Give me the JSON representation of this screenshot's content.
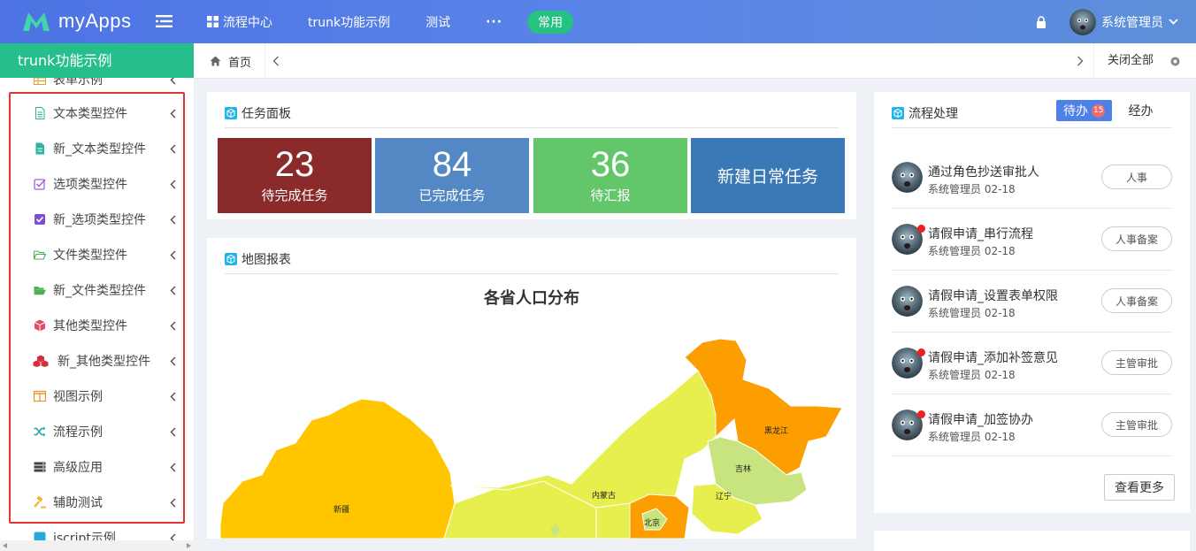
{
  "app": {
    "logo_text": "myApps"
  },
  "nav": {
    "items": [
      "流程中心",
      "trunk功能示例",
      "测试"
    ],
    "more": "···",
    "pill": "常用"
  },
  "user": {
    "name": "系统管理员"
  },
  "sidebar": {
    "title": "trunk功能示例",
    "items": [
      {
        "label": "表单示例",
        "icon": "table-icon"
      },
      {
        "label": "文本类型控件",
        "icon": "file-text-icon"
      },
      {
        "label": "新_文本类型控件",
        "icon": "file-solid-icon"
      },
      {
        "label": "选项类型控件",
        "icon": "checkbox-icon"
      },
      {
        "label": "新_选项类型控件",
        "icon": "checkbox-solid-icon"
      },
      {
        "label": "文件类型控件",
        "icon": "folder-open-icon"
      },
      {
        "label": "新_文件类型控件",
        "icon": "folder-solid-icon"
      },
      {
        "label": "其他类型控件",
        "icon": "cube-icon"
      },
      {
        "label": "新_其他类型控件",
        "icon": "cubes-icon"
      },
      {
        "label": "视图示例",
        "icon": "columns-icon"
      },
      {
        "label": "流程示例",
        "icon": "shuffle-icon"
      },
      {
        "label": "高级应用",
        "icon": "server-icon"
      },
      {
        "label": "辅助测试",
        "icon": "gavel-icon"
      },
      {
        "label": "jscript示例",
        "icon": "js-icon"
      }
    ]
  },
  "tabbar": {
    "home": "首页",
    "close_all": "关闭全部"
  },
  "task_panel": {
    "title": "任务面板",
    "stats": [
      {
        "value": "23",
        "label": "待完成任务",
        "color": "#8b2a2a"
      },
      {
        "value": "84",
        "label": "已完成任务",
        "color": "#5388c4"
      },
      {
        "value": "36",
        "label": "待汇报",
        "color": "#63c66b"
      }
    ],
    "new_task": {
      "label": "新建日常任务",
      "color": "#3a79b6"
    }
  },
  "map_panel": {
    "title": "地图报表",
    "chart_title": "各省人口分布",
    "regions": [
      "新疆",
      "内蒙古",
      "黑龙江",
      "吉林",
      "辽宁",
      "北京"
    ]
  },
  "flow_panel": {
    "title": "流程处理",
    "tab_active": "待办",
    "badge": "15",
    "tab_other": "经办",
    "items": [
      {
        "title": "通过角色抄送审批人",
        "sub": "系统管理员 02-18",
        "tag": "人事",
        "unread": false
      },
      {
        "title": "请假申请_串行流程",
        "sub": "系统管理员 02-18",
        "tag": "人事备案",
        "unread": true
      },
      {
        "title": "请假申请_设置表单权限",
        "sub": "系统管理员 02-18",
        "tag": "人事备案",
        "unread": false
      },
      {
        "title": "请假申请_添加补签意见",
        "sub": "系统管理员 02-18",
        "tag": "主管审批",
        "unread": true
      },
      {
        "title": "请假申请_加签协办",
        "sub": "系统管理员 02-18",
        "tag": "主管审批",
        "unread": true
      }
    ],
    "more": "查看更多"
  }
}
